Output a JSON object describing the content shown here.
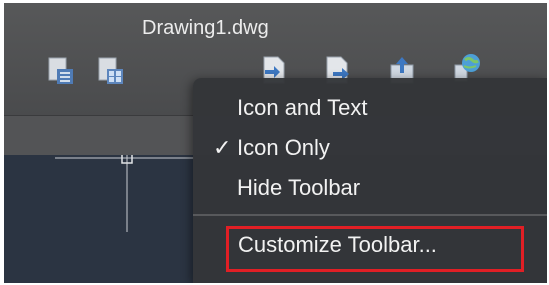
{
  "window": {
    "title": "Drawing1.dwg"
  },
  "toolbar": {
    "icons": [
      "document-list-icon",
      "document-grid-icon",
      "import-icon",
      "export-icon",
      "upload-icon",
      "share-globe-icon"
    ]
  },
  "menu": {
    "items": [
      {
        "label": "Icon and Text",
        "checked": false
      },
      {
        "label": "Icon Only",
        "checked": true,
        "check_glyph": "✓"
      },
      {
        "label": "Hide Toolbar",
        "checked": false
      }
    ],
    "customize_label": "Customize Toolbar...",
    "highlight_color": "#e11f25"
  }
}
